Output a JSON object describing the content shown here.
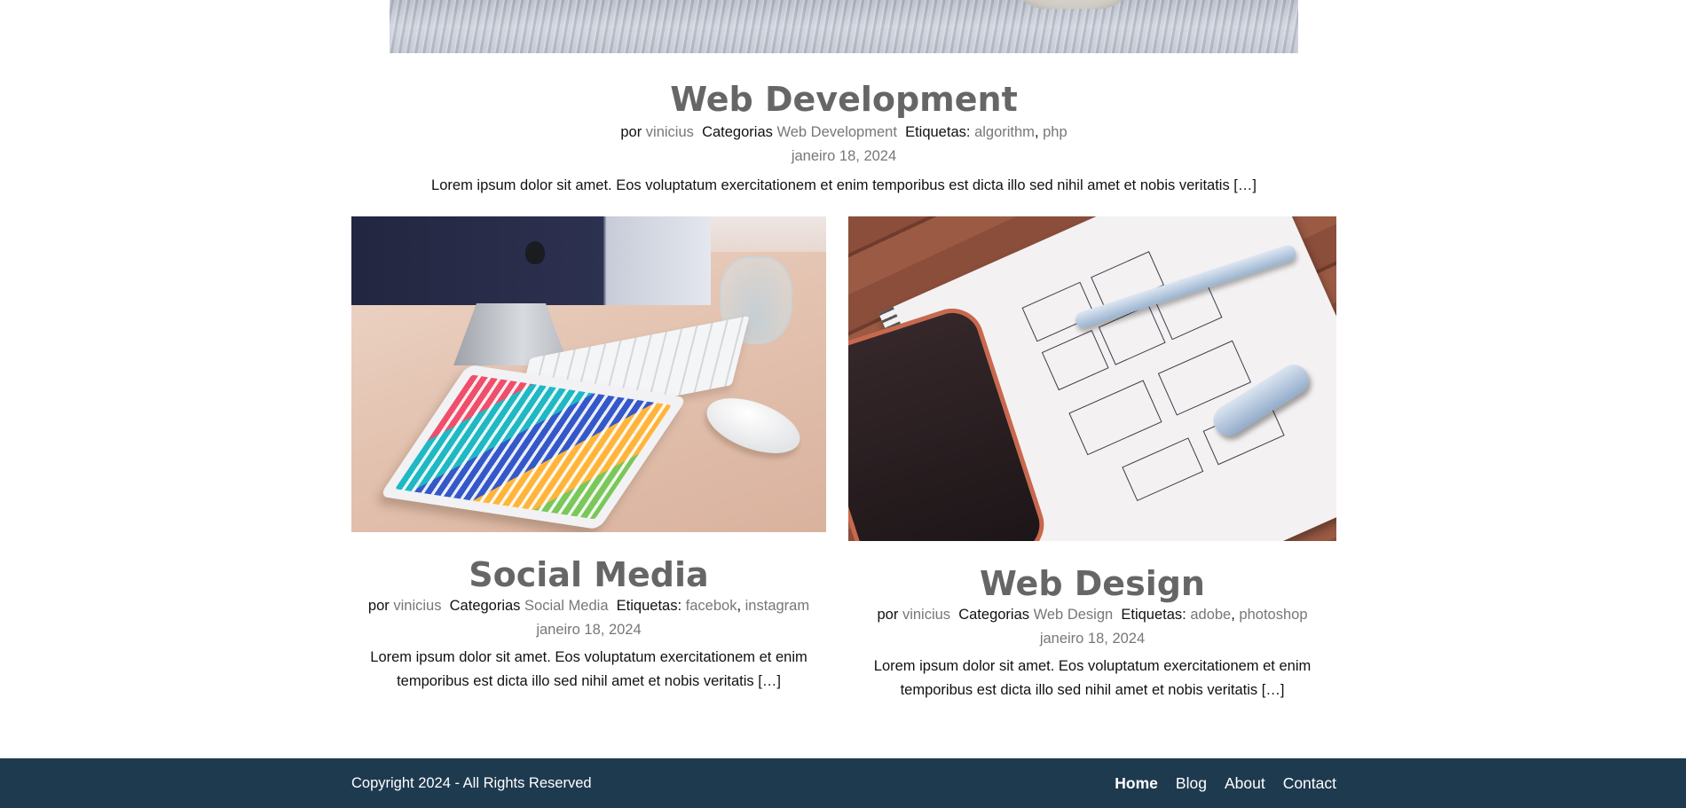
{
  "featured_post": {
    "image_alt_icon": "desk-wood-photo",
    "title": "Web Development",
    "by_label": "por",
    "author": "vinicius",
    "categories_label": "Categorias",
    "category": "Web Development",
    "tags_label": "Etiquetas:",
    "tags": [
      "algorithm",
      "php"
    ],
    "tag_separator": ",",
    "date": "janeiro 18, 2024",
    "excerpt": "Lorem ipsum dolor sit amet. Eos voluptatum exercitationem et enim temporibus est dicta illo sed nihil amet et nobis veritatis […]"
  },
  "posts": [
    {
      "title": "Social Media",
      "by_label": "por",
      "author": "vinicius",
      "categories_label": "Categorias",
      "category": "Social Media",
      "tags_label": "Etiquetas:",
      "tags": [
        "facebok",
        "instagram"
      ],
      "tag_separator": ",",
      "date": "janeiro 18, 2024",
      "excerpt": "Lorem ipsum dolor sit amet. Eos voluptatum exercitationem et enim temporibus est dicta illo sed nihil amet et nobis veritatis […]"
    },
    {
      "title": "Web Design",
      "by_label": "por",
      "author": "vinicius",
      "categories_label": "Categorias",
      "category": "Web Design",
      "tags_label": "Etiquetas:",
      "tags": [
        "adobe",
        "photoshop"
      ],
      "tag_separator": ",",
      "date": "janeiro 18, 2024",
      "excerpt": "Lorem ipsum dolor sit amet. Eos voluptatum exercitationem et enim temporibus est dicta illo sed nihil amet et nobis veritatis […]"
    }
  ],
  "footer": {
    "copyright": "Copyright 2024 - All Rights Reserved",
    "nav": [
      {
        "label": "Home",
        "active": true
      },
      {
        "label": "Blog",
        "active": false
      },
      {
        "label": "About",
        "active": false
      },
      {
        "label": "Contact",
        "active": false
      }
    ],
    "background": "#1e3a4f"
  },
  "colors": {
    "title": "#666666",
    "muted_link": "#777777",
    "text": "#111111"
  }
}
